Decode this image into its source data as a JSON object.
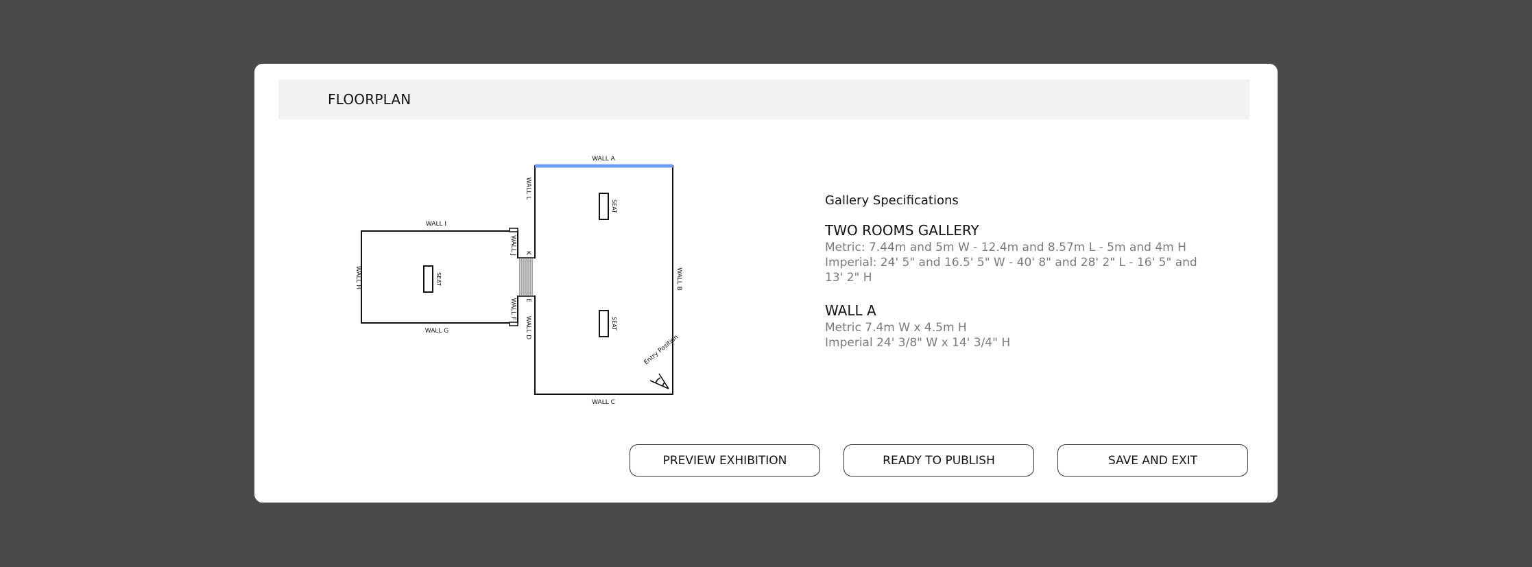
{
  "header": {
    "title": "FLOORPLAN"
  },
  "floorplan": {
    "walls": {
      "a": "WALL A",
      "b": "WALL B",
      "c": "WALL C",
      "d": "WALL D",
      "e": "E",
      "f": "WALL F",
      "g": "WALL G",
      "h": "WALL H",
      "i": "WALL I",
      "j": "WALL J",
      "k": "K",
      "l": "WALL L"
    },
    "seat_label": "SEAT",
    "entry_label": "Entry Position",
    "selected_wall": "WALL A",
    "highlight_color": "#6e9df3"
  },
  "specs": {
    "heading": "Gallery Specifications",
    "gallery_name": "TWO ROOMS GALLERY",
    "gallery_metric": "Metric: 7.44m and 5m W - 12.4m and 8.57m L - 5m and 4m H",
    "gallery_imperial": "Imperial: 24' 5\" and 16.5' 5\" W - 40' 8\" and 28' 2\" L - 16' 5\" and 13' 2\" H",
    "wall_name": "WALL A",
    "wall_metric": "Metric 7.4m W x 4.5m H",
    "wall_imperial": "Imperial 24' 3/8\" W x 14' 3/4\" H"
  },
  "buttons": {
    "preview": "PREVIEW EXHIBITION",
    "publish": "READY TO PUBLISH",
    "save": "SAVE AND EXIT"
  }
}
